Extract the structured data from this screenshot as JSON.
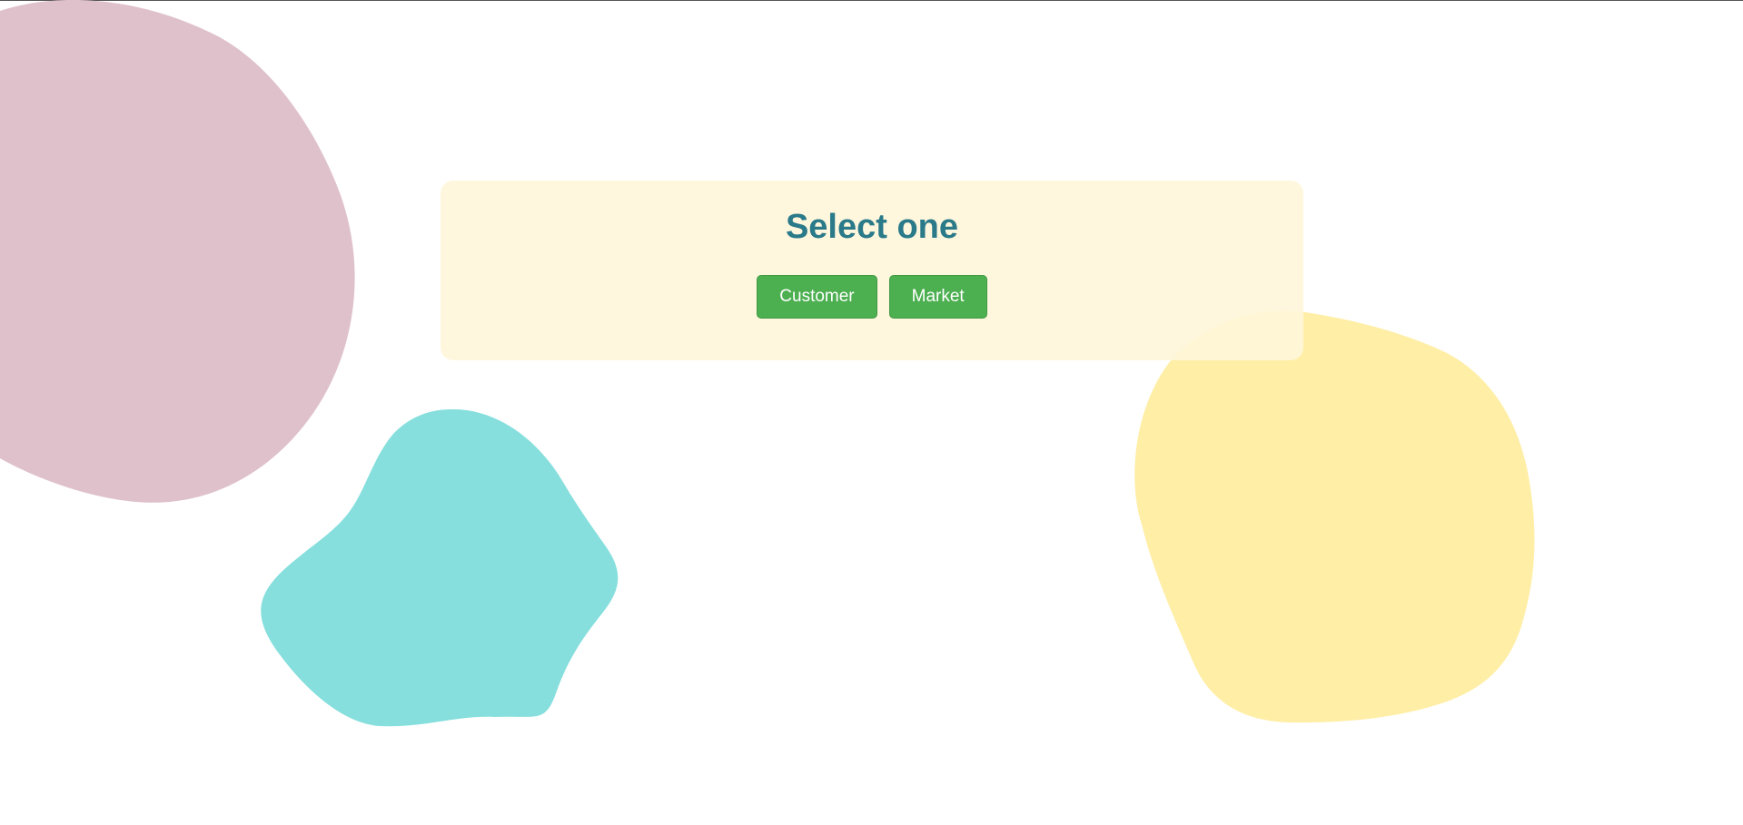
{
  "dialog": {
    "title": "Select one",
    "buttons": [
      {
        "label": "Customer"
      },
      {
        "label": "Market"
      }
    ]
  },
  "colors": {
    "background": "#ffffff",
    "card": "#fff6da",
    "title": "#2a7a8a",
    "button": "#4caf50",
    "button_text": "#ffffff",
    "blob_pink": "#dfc1cc",
    "blob_teal": "#86dfdd",
    "blob_yellow": "#ffeea6"
  }
}
